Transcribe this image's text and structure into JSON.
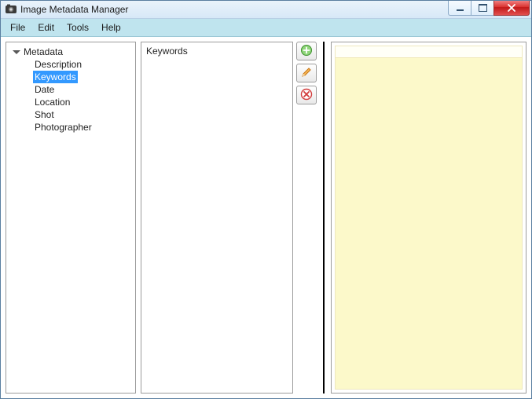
{
  "window": {
    "title": "Image Metadata Manager"
  },
  "menu": {
    "file": "File",
    "edit": "Edit",
    "tools": "Tools",
    "help": "Help"
  },
  "tree": {
    "root_label": "Metadata",
    "items": [
      {
        "label": "Description",
        "selected": false
      },
      {
        "label": "Keywords",
        "selected": true
      },
      {
        "label": "Date",
        "selected": false
      },
      {
        "label": "Location",
        "selected": false
      },
      {
        "label": "Shot",
        "selected": false
      },
      {
        "label": "Photographer",
        "selected": false
      }
    ]
  },
  "mid": {
    "heading": "Keywords"
  },
  "buttons": {
    "add": "add-icon",
    "edit": "edit-icon",
    "delete": "delete-icon"
  }
}
